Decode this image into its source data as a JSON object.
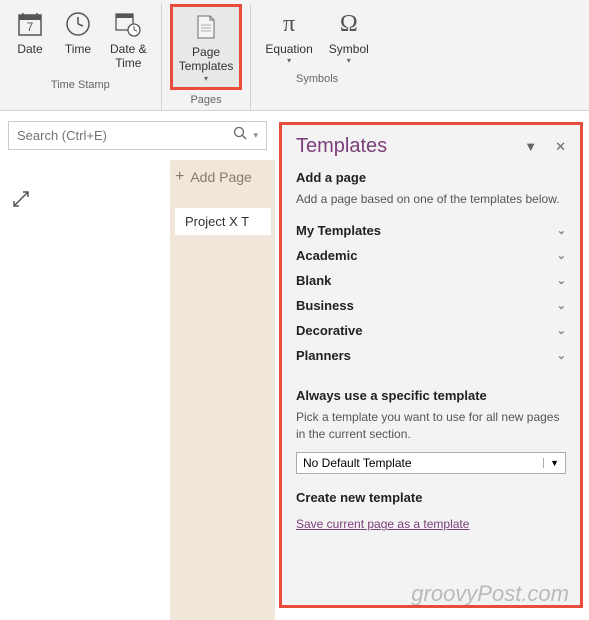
{
  "ribbon": {
    "groups": [
      {
        "label": "Time Stamp",
        "buttons": [
          {
            "label": "Date"
          },
          {
            "label": "Time"
          },
          {
            "label": "Date &\nTime"
          }
        ]
      },
      {
        "label": "Pages",
        "buttons": [
          {
            "label": "Page\nTemplates",
            "dropdown": true,
            "highlighted": true
          }
        ]
      },
      {
        "label": "Symbols",
        "buttons": [
          {
            "label": "Equation",
            "dropdown": true
          },
          {
            "label": "Symbol",
            "dropdown": true
          }
        ]
      }
    ]
  },
  "search": {
    "placeholder": "Search (Ctrl+E)"
  },
  "addPage": {
    "label": "Add Page"
  },
  "pageTab": {
    "label": "Project X T"
  },
  "templates": {
    "title": "Templates",
    "addPage": {
      "heading": "Add a page",
      "desc": "Add a page based on one of the templates below."
    },
    "categories": [
      "My Templates",
      "Academic",
      "Blank",
      "Business",
      "Decorative",
      "Planners"
    ],
    "alwaysUse": {
      "heading": "Always use a specific template",
      "desc": "Pick a template you want to use for all new pages in the current section.",
      "selected": "No Default Template"
    },
    "createNew": {
      "heading": "Create new template",
      "link": "Save current page as a template"
    }
  },
  "watermark": "groovyPost.com"
}
